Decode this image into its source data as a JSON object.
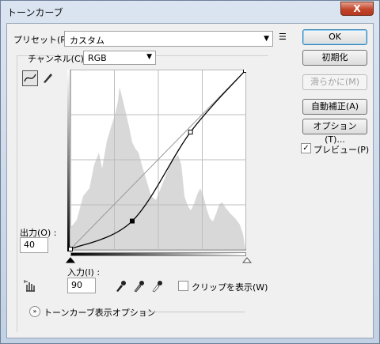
{
  "window": {
    "title": "トーンカーブ",
    "close_glyph": "X"
  },
  "preset": {
    "label": "プリセット(R) :",
    "value": "カスタム"
  },
  "channel": {
    "label": "チャンネル(C) :",
    "value": "RGB"
  },
  "output": {
    "label": "出力(O) :",
    "value": "40"
  },
  "input": {
    "label": "入力(I) :",
    "value": "90"
  },
  "clipping": {
    "label": "クリップを表示(W)",
    "checked": false
  },
  "options_toggle": {
    "label": "トーンカーブ表示オプション"
  },
  "buttons": {
    "ok": "OK",
    "reset": "初期化",
    "smooth": "滑らかに(M)",
    "auto": "自動補正(A)",
    "options": "オプション(T)..."
  },
  "preview": {
    "label": "プレビュー(P)",
    "checked": true
  },
  "curve": {
    "points": [
      {
        "input": 0,
        "output": 0
      },
      {
        "input": 90,
        "output": 40
      },
      {
        "input": 175,
        "output": 167
      },
      {
        "input": 255,
        "output": 255
      }
    ]
  }
}
